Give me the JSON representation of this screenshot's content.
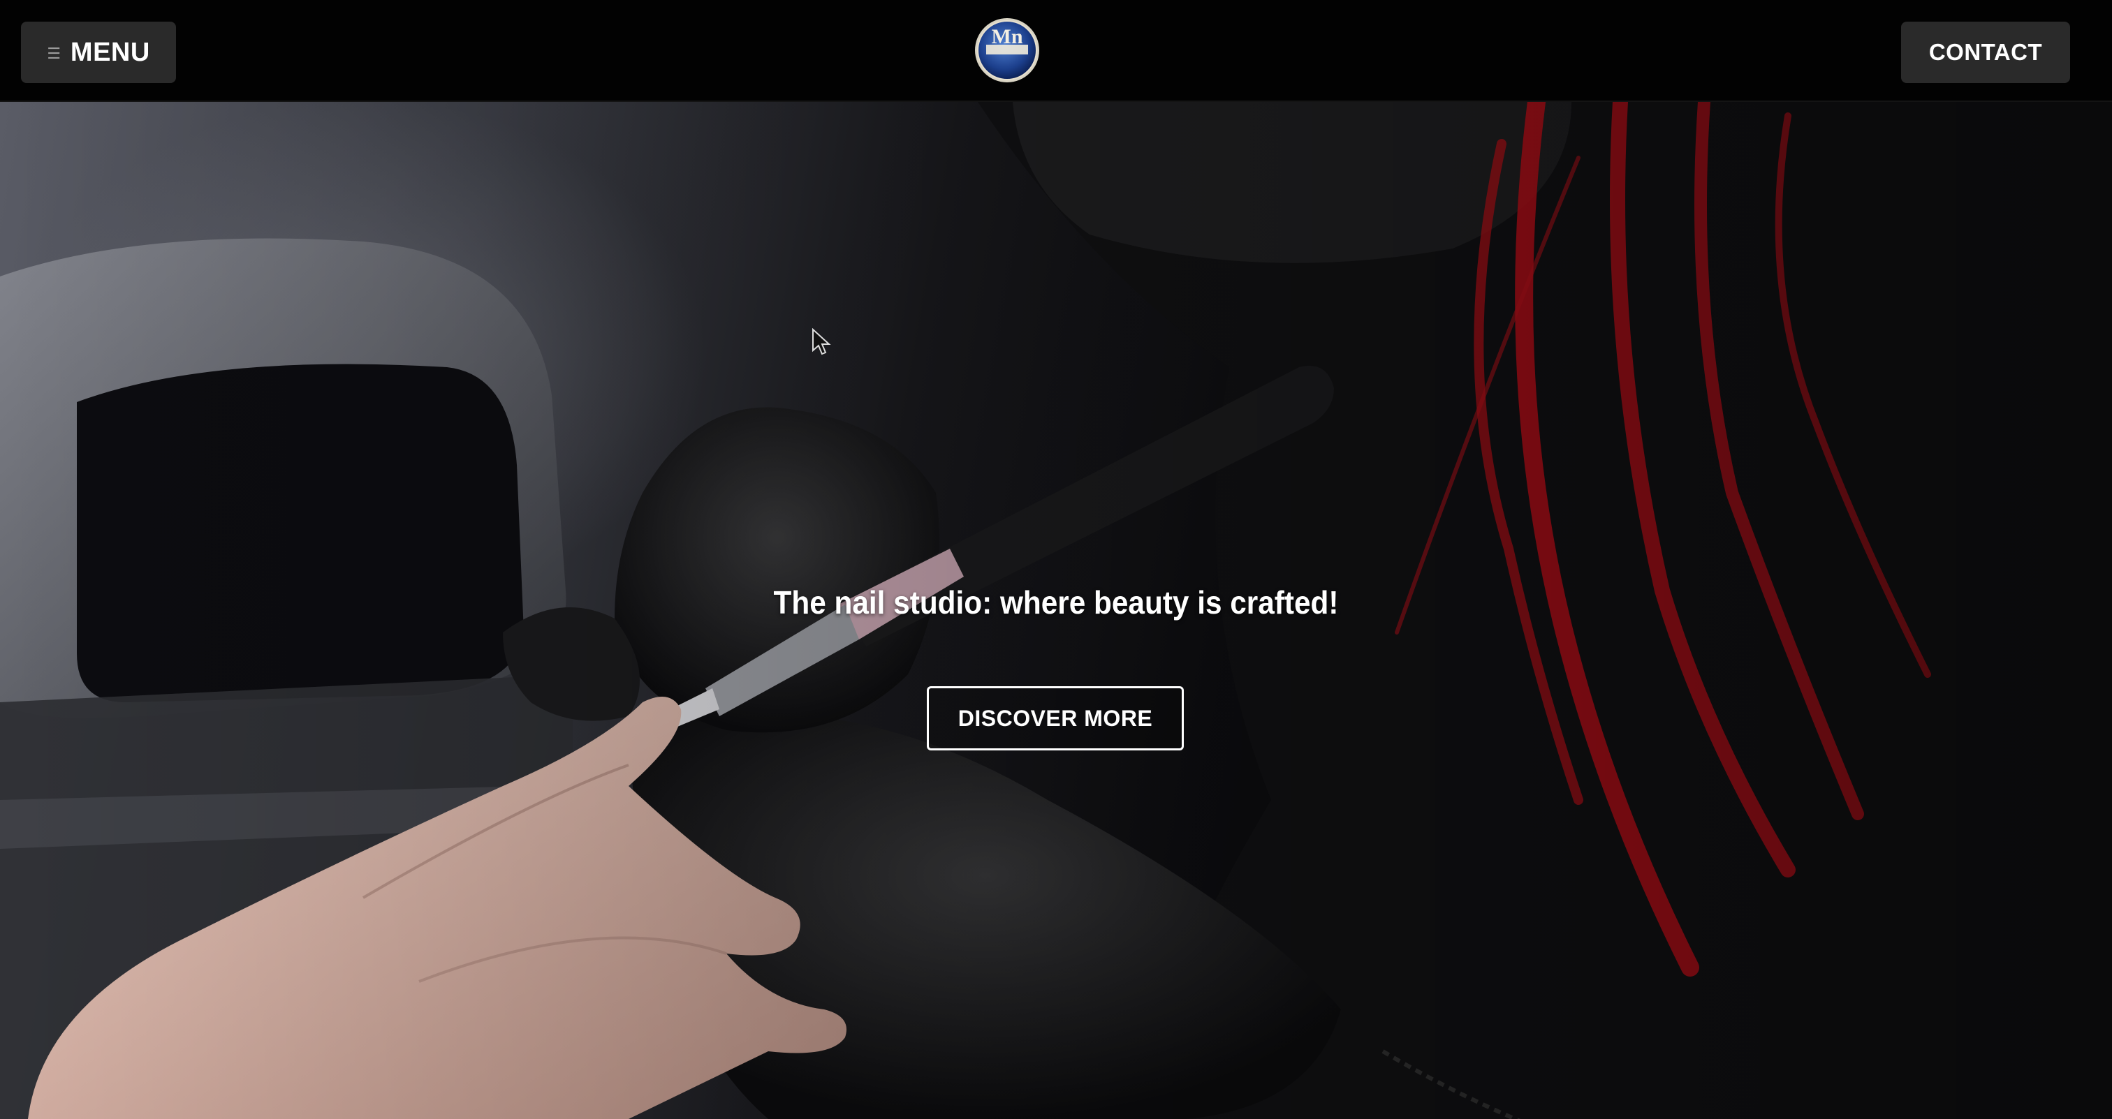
{
  "header": {
    "menu_icon": "☰",
    "menu_label": "MENU",
    "logo": {
      "icon": "circular-seal-logo",
      "monogram": "Mn"
    },
    "contact_label": "CONTACT"
  },
  "hero": {
    "title": "The nail studio: where beauty is crafted!",
    "cta_label": "DISCOVER MORE",
    "background_image": "nail-technician-manicure-photo"
  },
  "colors": {
    "header_bg": "#020202",
    "button_bg": "#2a2a2a",
    "text": "#ffffff",
    "hair_accent": "#c0101a"
  }
}
